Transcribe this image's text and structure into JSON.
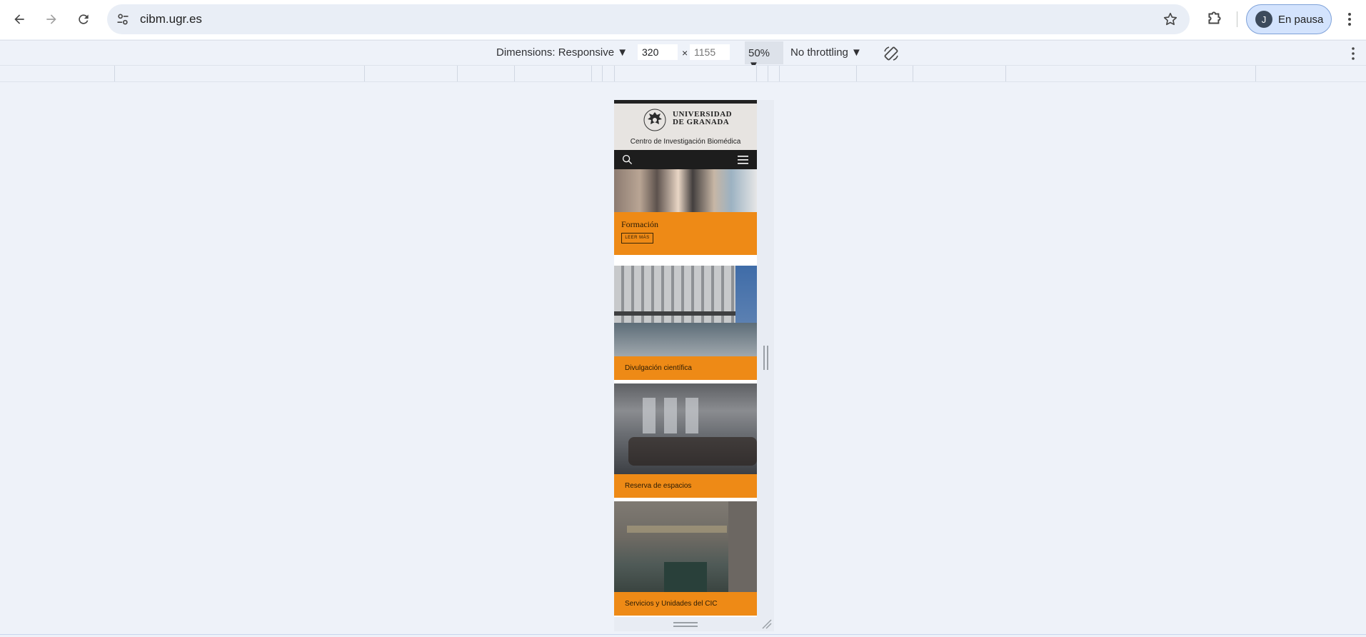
{
  "browser": {
    "url": "cibm.ugr.es",
    "profile_initial": "J",
    "profile_label": "En pausa"
  },
  "devtools": {
    "dimensions_label": "Dimensions: Responsive ▼",
    "width_value": "320",
    "height_placeholder": "1155",
    "times": "×",
    "zoom": "50% ▼",
    "throttling": "No throttling ▼"
  },
  "page": {
    "university_line1": "UNIVERSIDAD",
    "university_line2": "DE GRANADA",
    "center_name": "Centro de Investigación Biomédica",
    "cards": [
      {
        "title": "Formación",
        "button": "LEER MÁS"
      },
      {
        "title": "Divulgación científica"
      },
      {
        "title": "Reserva de espacios"
      },
      {
        "title": "Servicios y Unidades del CIC"
      }
    ]
  },
  "icons": {
    "back": "arrow-left-icon",
    "forward": "arrow-right-icon",
    "reload": "reload-icon",
    "site_info": "tune-icon",
    "bookmark": "star-icon",
    "extensions": "puzzle-icon",
    "menu": "kebab-icon",
    "rotate": "rotate-icon",
    "search": "search-icon",
    "hamburger": "hamburger-icon"
  }
}
